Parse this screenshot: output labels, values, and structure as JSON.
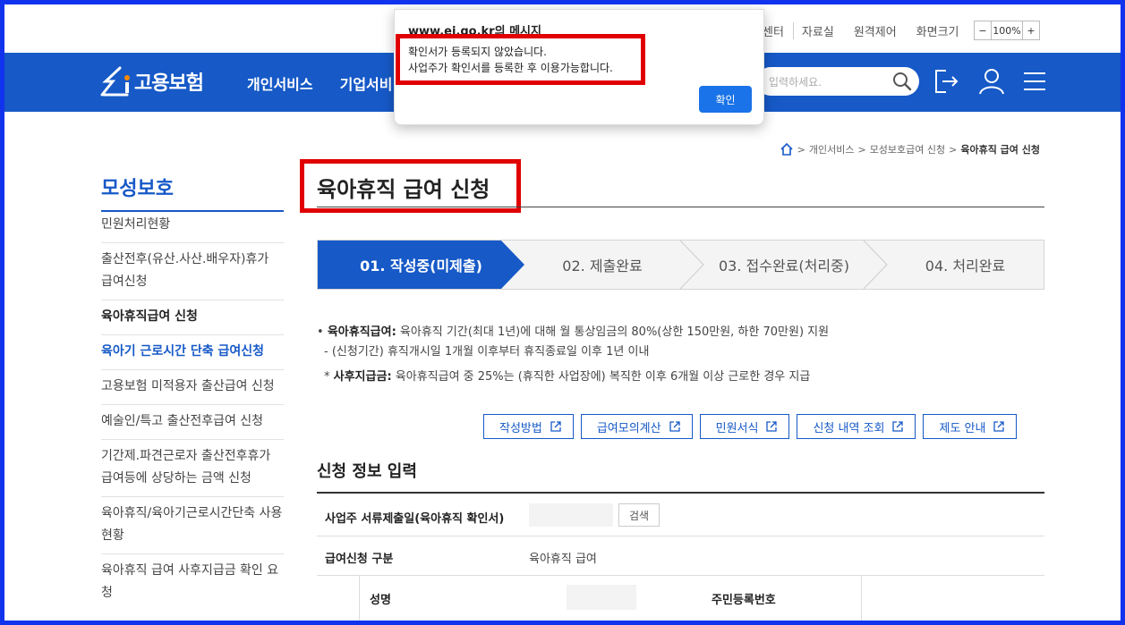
{
  "utility": {
    "links": [
      "센터",
      "자료실",
      "원격제어"
    ],
    "zoom_label": "화면크기",
    "zoom_minus": "−",
    "zoom_value": "100%",
    "zoom_plus": "+"
  },
  "nav": {
    "logo_text": "고용보험",
    "menu": [
      "개인서비스",
      "기업서비"
    ],
    "search_placeholder": "입력하세요."
  },
  "breadcrumb": {
    "items": [
      "개인서비스",
      "모성보호급여 신청"
    ],
    "current": "육아휴직 급여 신청"
  },
  "sidebar": {
    "title": "모성보호",
    "items": [
      {
        "label": "민원처리현황",
        "state": "normal"
      },
      {
        "label": "출산전후(유산.사산.배우자)휴가 급여신청",
        "state": "normal"
      },
      {
        "label": "육아휴직급여 신청",
        "state": "bold"
      },
      {
        "label": "육아기 근로시간 단축 급여신청",
        "state": "active"
      },
      {
        "label": "고용보험 미적용자 출산급여 신청",
        "state": "normal"
      },
      {
        "label": "예술인/특고 출산전후급여 신청",
        "state": "normal"
      },
      {
        "label": "기간제.파견근로자 출산전후휴가 급여등에 상당하는 금액 신청",
        "state": "normal"
      },
      {
        "label": "육아휴직/육아기근로시간단축 사용현황",
        "state": "normal"
      },
      {
        "label": "육아휴직 급여 사후지급금 확인 요청",
        "state": "normal"
      }
    ]
  },
  "page": {
    "title": "육아휴직 급여 신청"
  },
  "steps": [
    {
      "label": "01. 작성중(미제출)",
      "active": true
    },
    {
      "label": "02. 제출완료",
      "active": false
    },
    {
      "label": "03. 접수완료(처리중)",
      "active": false
    },
    {
      "label": "04. 처리완료",
      "active": false
    }
  ],
  "info": {
    "line1_label": "육아휴직급여:",
    "line1_text": "육아휴직 기간(최대 1년)에 대해 월 통상임금의 80%(상한 150만원, 하한 70만원) 지원",
    "line2": "- (신청기간) 휴직개시일 1개월 이후부터 휴직종료일 이후 1년 이내",
    "line3_label": "사후지급금:",
    "line3_text": "육아휴직급여 중 25%는 (휴직한 사업장에) 복직한 이후 6개월 이상 근로한 경우 지급"
  },
  "actions": [
    "작성방법",
    "급여모의계산",
    "민원서식",
    "신청 내역 조회",
    "제도 안내"
  ],
  "form": {
    "section_title": "신청 정보 입력",
    "row1_label": "사업주 서류제출일(육아휴직 확인서)",
    "row1_button": "검색",
    "row2_label": "급여신청 구분",
    "row2_value": "육아휴직 급여",
    "row3_label_a": "성명",
    "row3_label_b": "주민등록번호"
  },
  "dialog": {
    "title": "www.ei.go.kr의 메시지",
    "message_line1": "확인서가 등록되지 않았습니다.",
    "message_line2": "사업주가 확인서를 등록한 후 이용가능합니다.",
    "ok_label": "확인"
  },
  "colors": {
    "brand_blue": "#1659c7",
    "frame_blue": "#1133ee",
    "highlight_red": "#e00000",
    "dialog_button": "#1a73e8"
  }
}
